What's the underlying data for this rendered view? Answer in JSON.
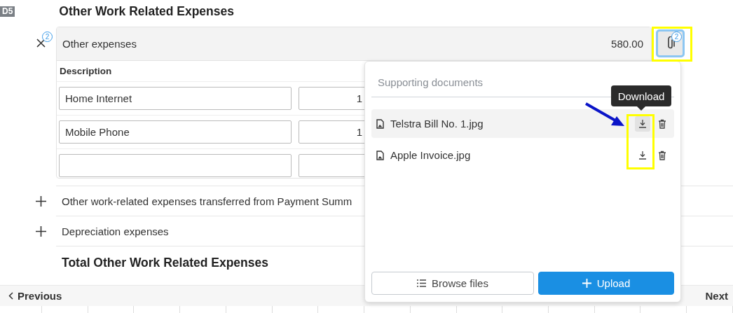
{
  "section": {
    "code": "D5",
    "title": "Other Work Related Expenses"
  },
  "expense": {
    "label": "Other expenses",
    "amount": "580.00",
    "expanded": true,
    "toggle_badge": "2",
    "attach_badge": "2",
    "attach_active": true,
    "column_header": "Description",
    "items": [
      {
        "kind": "entry",
        "description": "Home Internet",
        "amount": "1"
      },
      {
        "kind": "entry",
        "description": "Mobile Phone",
        "amount": "1"
      },
      {
        "kind": "blank"
      }
    ]
  },
  "rows": [
    {
      "label": "Other work-related expenses transferred from Payment Summ",
      "expanded": false
    },
    {
      "label": "Depreciation expenses",
      "expanded": false
    }
  ],
  "total": "Total Other Work Related Expenses",
  "popup": {
    "title": "Supporting documents",
    "tooltip": "Download",
    "files": [
      {
        "name": "Telstra Bill No. 1.jpg",
        "hovered": true
      },
      {
        "name": "Apple Invoice.jpg",
        "hovered": false
      }
    ],
    "buttons": [
      {
        "label": "Browse files",
        "kind": "secondary"
      },
      {
        "label": "Upload",
        "kind": "primary"
      }
    ]
  },
  "nav": {
    "previous": "Previous",
    "next": "Next"
  }
}
